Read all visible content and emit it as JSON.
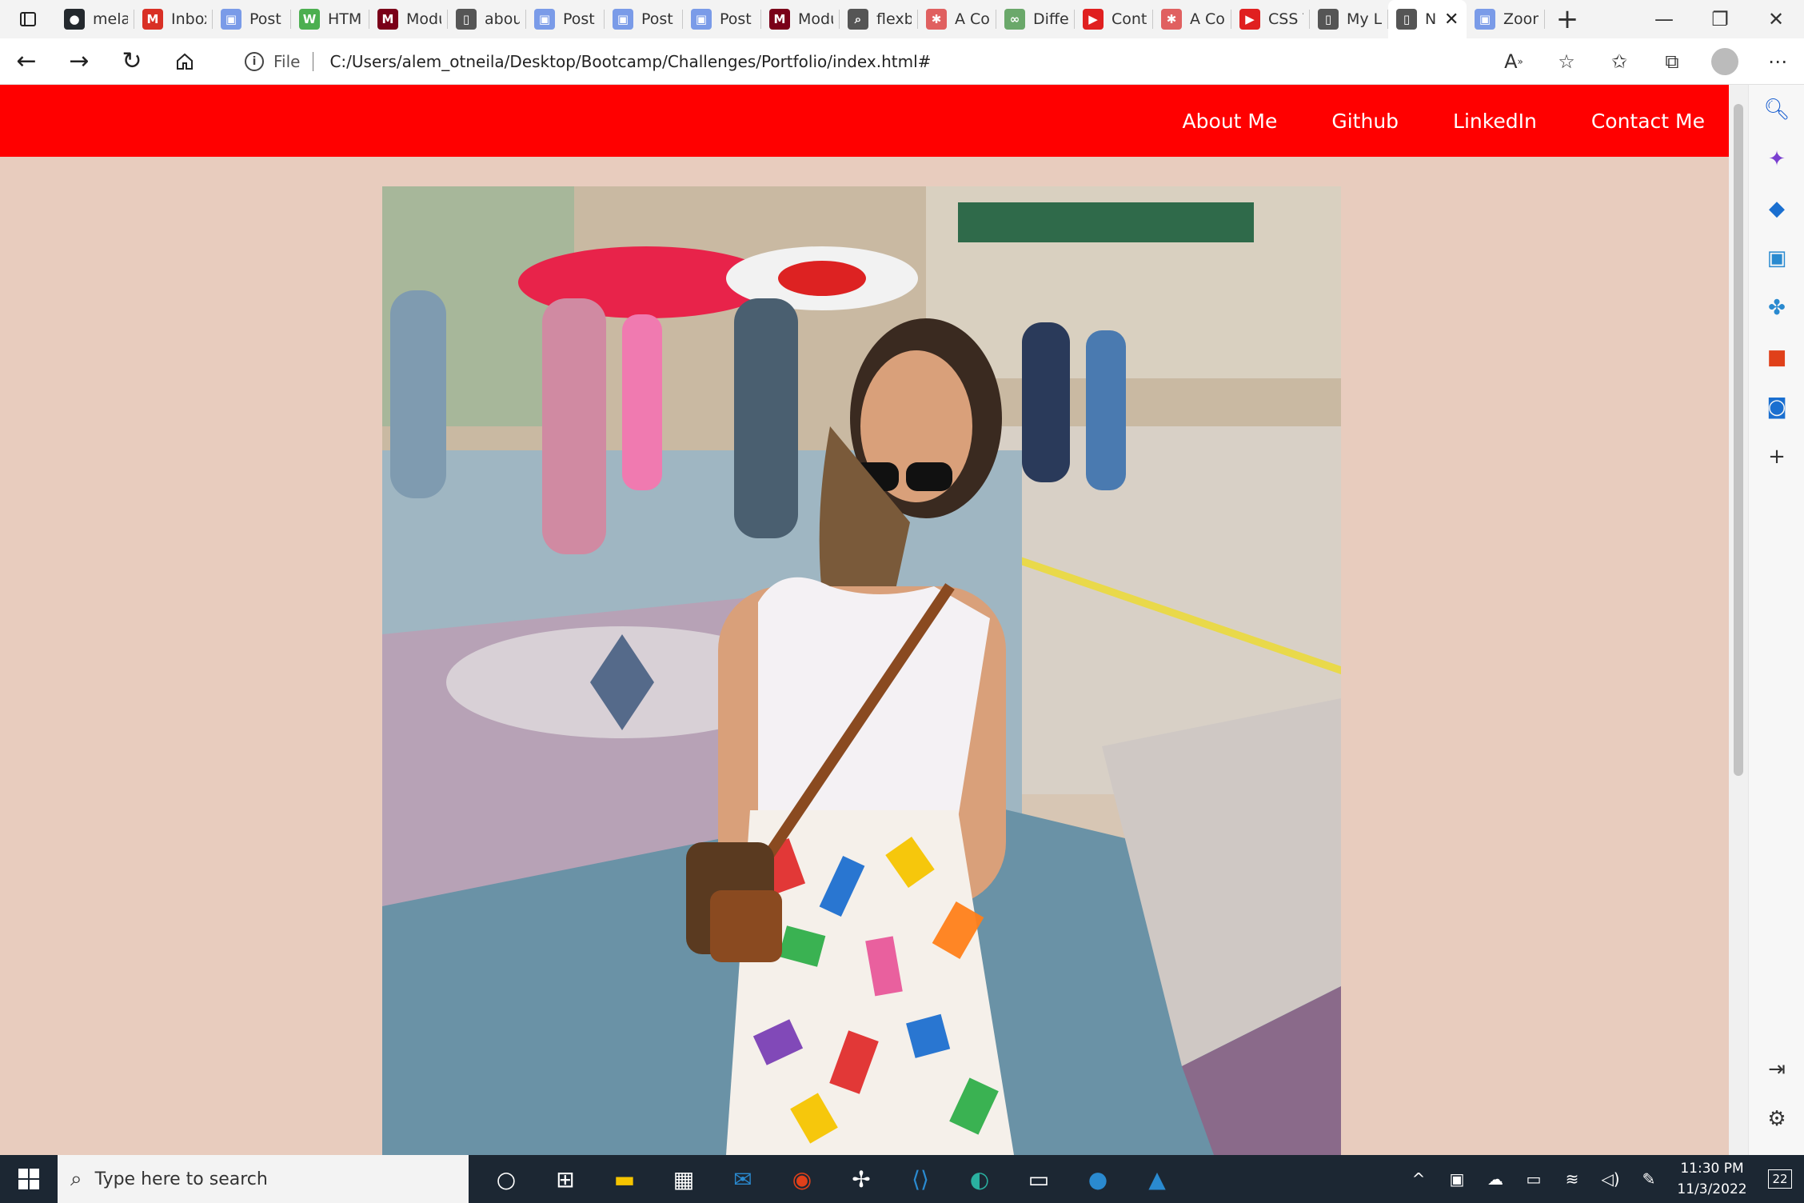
{
  "browser": {
    "tabs": [
      {
        "label": "mela",
        "icon": "github-icon"
      },
      {
        "label": "Inbox",
        "icon": "gmail-icon"
      },
      {
        "label": "Post",
        "icon": "zoom-icon"
      },
      {
        "label": "HTM",
        "icon": "w3schools-icon"
      },
      {
        "label": "Modu",
        "icon": "minnesota-icon"
      },
      {
        "label": "abou",
        "icon": "file-icon"
      },
      {
        "label": "Post",
        "icon": "zoom-icon"
      },
      {
        "label": "Post",
        "icon": "zoom-icon"
      },
      {
        "label": "Post",
        "icon": "zoom-icon"
      },
      {
        "label": "Modu",
        "icon": "minnesota-icon"
      },
      {
        "label": "flexb",
        "icon": "search-icon"
      },
      {
        "label": "A Co",
        "icon": "asterisk-icon"
      },
      {
        "label": "Differ",
        "icon": "link-icon"
      },
      {
        "label": "Conti",
        "icon": "youtube-icon"
      },
      {
        "label": "A Co",
        "icon": "asterisk-icon"
      },
      {
        "label": "CSS T",
        "icon": "youtube-icon"
      },
      {
        "label": "My L",
        "icon": "file-icon"
      },
      {
        "label": "N",
        "icon": "file-icon",
        "active": true
      },
      {
        "label": "Zoon",
        "icon": "zoom-icon"
      }
    ],
    "address": {
      "scheme": "File",
      "url": "C:/Users/alem_otneila/Desktop/Bootcamp/Challenges/Portfolio/index.html#"
    }
  },
  "site": {
    "nav": [
      "About Me",
      "Github",
      "LinkedIn",
      "Contact Me"
    ],
    "colors": {
      "nav_bg": "#ff0000",
      "page_bg": "#e8ccbe"
    }
  },
  "taskbar": {
    "search_placeholder": "Type here to search",
    "time": "11:30 PM",
    "date": "11/3/2022",
    "notifications": "22"
  }
}
